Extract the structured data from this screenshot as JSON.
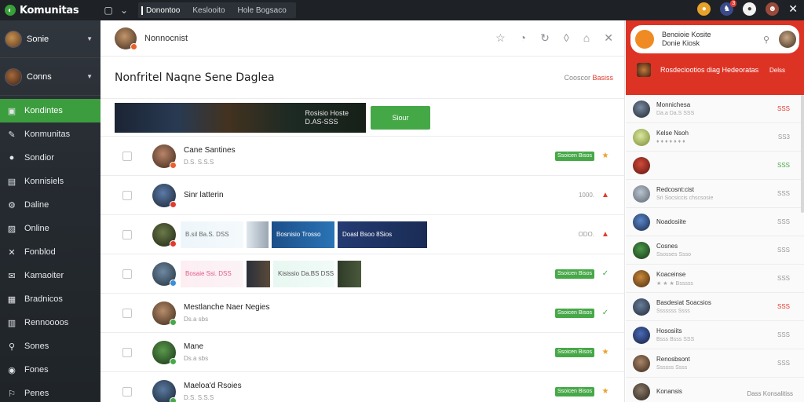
{
  "app": {
    "title": "Komunitas"
  },
  "topbar": {
    "tabs": [
      "Donontoo",
      "Keslooito",
      "Hole Bogsaco"
    ],
    "notification_count": "3"
  },
  "sidebar": {
    "users": [
      {
        "name": "Sonie"
      },
      {
        "name": "Conns"
      }
    ],
    "items": [
      {
        "label": "Kondintes",
        "icon": "bookmark-icon",
        "glyph": "▣",
        "active": true
      },
      {
        "label": "Konmunitas",
        "icon": "pen-icon",
        "glyph": "✎"
      },
      {
        "label": "Sondior",
        "icon": "user-icon",
        "glyph": "●"
      },
      {
        "label": "Konnisiels",
        "icon": "doc-icon",
        "glyph": "▤"
      },
      {
        "label": "Daline",
        "icon": "settings-icon",
        "glyph": "⚙"
      },
      {
        "label": "Online",
        "icon": "image-icon",
        "glyph": "▨"
      },
      {
        "label": "Fonblod",
        "icon": "tools-icon",
        "glyph": "✕"
      },
      {
        "label": "Kamaoiter",
        "icon": "mail-icon",
        "glyph": "✉"
      },
      {
        "label": "Bradnicos",
        "icon": "grid-icon",
        "glyph": "▦"
      },
      {
        "label": "Rennoooos",
        "icon": "list-icon",
        "glyph": "▥"
      },
      {
        "label": "Sones",
        "icon": "link-icon",
        "glyph": "⚲"
      },
      {
        "label": "Fones",
        "icon": "globe-icon",
        "glyph": "◉"
      },
      {
        "label": "Penes",
        "icon": "share-icon",
        "glyph": "⚐"
      }
    ]
  },
  "main": {
    "header": {
      "title": "Nonnocnist"
    },
    "section": {
      "title": "Nonfritel Naqne Sene Daglea",
      "meta_label": "Cooscor",
      "meta_value": "Basiss"
    },
    "banner": {
      "text_line1": "Rosisio Hoste",
      "text_line2": "D.AS-SSS",
      "button_label": "Siour"
    },
    "rows": [
      {
        "name": "Cane Santines",
        "sub": "D.S. S.S.S",
        "badge_label": "Ssoicen Bisos",
        "count": "",
        "flag": "★",
        "flag_color": "#e8a22a",
        "avatar_colors": [
          "#b9846a",
          "#3b2616"
        ],
        "badge_color": "#e8602c",
        "thumbs": []
      },
      {
        "name": "Sinr latterin",
        "sub": "",
        "badge_label": "",
        "count": "1000.",
        "flag": "▲",
        "flag_color": "#e23b2e",
        "avatar_colors": [
          "#5b7ba8",
          "#1a2330"
        ],
        "badge_color": "#e23b2e",
        "thumbs": []
      },
      {
        "name": "",
        "sub": "",
        "badge_label": "",
        "count": "ODO.",
        "flag": "▲",
        "flag_color": "#e23b2e",
        "avatar_colors": [
          "#6b7a48",
          "#1d2414"
        ],
        "badge_color": "#e23b2e",
        "thumbs": [
          {
            "label": "B.sil  Ba.S.  DSS",
            "w": 80,
            "c1": "#eef6fb",
            "c2": "#f4f9fc",
            "tc": "#666"
          },
          {
            "label": "",
            "w": 28,
            "c1": "#dfe7ee",
            "c2": "#9aa6b2",
            "tc": "#fff"
          },
          {
            "label": "Bosnisio Trosso",
            "w": 80,
            "c1": "#1c4f8a",
            "c2": "#2a74b5",
            "tc": "#fff"
          },
          {
            "label": "Doasl Bsoo  8Sios",
            "w": 114,
            "c1": "#243b72",
            "c2": "#1a2c55",
            "tc": "#fff"
          }
        ]
      },
      {
        "name": "",
        "sub": "",
        "badge_label": "Ssoicen Bisos",
        "count": "",
        "flag": "✓",
        "flag_color": "#47a848",
        "avatar_colors": [
          "#6f89a2",
          "#22303d"
        ],
        "badge_color": "#3a8fd8",
        "thumbs": [
          {
            "label": "Bosaie  Ssi. DSS",
            "w": 80,
            "c1": "#fdeef2",
            "c2": "#fbf3f6",
            "tc": "#e05a8a"
          },
          {
            "label": "",
            "w": 30,
            "c1": "#2a2f3a",
            "c2": "#5a4a3a",
            "tc": "#fff"
          },
          {
            "label": "Kisissio Da.BS DSS",
            "w": 78,
            "c1": "#e8f7f1",
            "c2": "#f1fbf7",
            "tc": "#555"
          },
          {
            "label": "",
            "w": 30,
            "c1": "#2f3b2a",
            "c2": "#4a5a3a",
            "tc": "#fff"
          }
        ]
      },
      {
        "name": "Mestlanche Naer Negies",
        "sub": "Ds.a sbs",
        "badge_label": "Ssoicen Bisos",
        "count": "",
        "flag": "✓",
        "flag_color": "#47a848",
        "avatar_colors": [
          "#b88d6c",
          "#3a2718"
        ],
        "badge_color": "#47a848",
        "thumbs": []
      },
      {
        "name": "Mane",
        "sub": "Ds.a sbs",
        "badge_label": "Ssoicen Bisos",
        "count": "",
        "flag": "★",
        "flag_color": "#e8a22a",
        "avatar_colors": [
          "#5a9a4a",
          "#18321a"
        ],
        "badge_color": "#47a848",
        "thumbs": []
      },
      {
        "name": "Maeloa'd Rsoies",
        "sub": "D.S. S.S.S",
        "badge_label": "Ssoicen Bisos",
        "count": "",
        "flag": "★",
        "flag_color": "#e8a22a",
        "avatar_colors": [
          "#5a7aa0",
          "#16222f"
        ],
        "badge_color": "#47a848",
        "thumbs": []
      }
    ]
  },
  "right_panel": {
    "header": {
      "title": "Benoioie Kosite",
      "subtitle": "Donie Kiosk",
      "sub_text": "Rosdeciootios diag Hedeoratas",
      "sub_value": "Delss"
    },
    "items": [
      {
        "name": "Monnichesa",
        "sub": "Da.a Da.S SSS",
        "value": "SSS",
        "value_color": "#e23b2e",
        "colors": [
          "#7a8aa0",
          "#1e2632"
        ]
      },
      {
        "name": "Kelse Nsoh",
        "sub": "♦ ♦ ♦ ♦ ♦ ♦ ♦",
        "value": "SS3",
        "value_color": "#999",
        "colors": [
          "#d9e8a0",
          "#7a8a30"
        ]
      },
      {
        "name": "",
        "sub": "",
        "value": "SSS",
        "value_color": "#47a848",
        "colors": [
          "#d24a3a",
          "#5a1410"
        ]
      },
      {
        "name": "Redcosnt:cist",
        "sub": "Sri Socsiccis chscsosie",
        "value": "SSS",
        "value_color": "#999",
        "colors": [
          "#b9c4cf",
          "#5a6470"
        ]
      },
      {
        "name": "Noadosiite",
        "sub": "",
        "value": "SSS",
        "value_color": "#999",
        "colors": [
          "#5a86c8",
          "#1a2a48"
        ]
      },
      {
        "name": "Cosnes",
        "sub": "Ssosses  Ssso",
        "value": "SSS",
        "value_color": "#999",
        "colors": [
          "#4a9a4a",
          "#1a3218"
        ]
      },
      {
        "name": "Koaceinse",
        "sub": "★ ★ ★  Bsssss",
        "value": "SSS",
        "value_color": "#999",
        "colors": [
          "#c98a3a",
          "#4a2a10"
        ]
      },
      {
        "name": "Basdesiat  Soacsios",
        "sub": "Sssssss  Ssss",
        "value": "SSS",
        "value_color": "#e23b2e",
        "colors": [
          "#6a7e9a",
          "#1e2836"
        ]
      },
      {
        "name": "Hososiits",
        "sub": "Bsss Bsss SSS",
        "value": "SSS",
        "value_color": "#999",
        "colors": [
          "#4a6ab8",
          "#141e3a"
        ]
      },
      {
        "name": "Renosbsont",
        "sub": "Ssssss  Ssss",
        "value": "SSS",
        "value_color": "#999",
        "colors": [
          "#a8866a",
          "#3a2618"
        ]
      },
      {
        "name": "Konansis",
        "sub": "",
        "value": "",
        "value_color": "#999",
        "colors": [
          "#8a7a6a",
          "#2a221a"
        ]
      }
    ],
    "footer_label": "Dass Konsalitiss"
  },
  "colors": {
    "accent_green": "#3c9d3f",
    "header_red": "#dd3325",
    "sidebar_bg": "#262b31"
  }
}
